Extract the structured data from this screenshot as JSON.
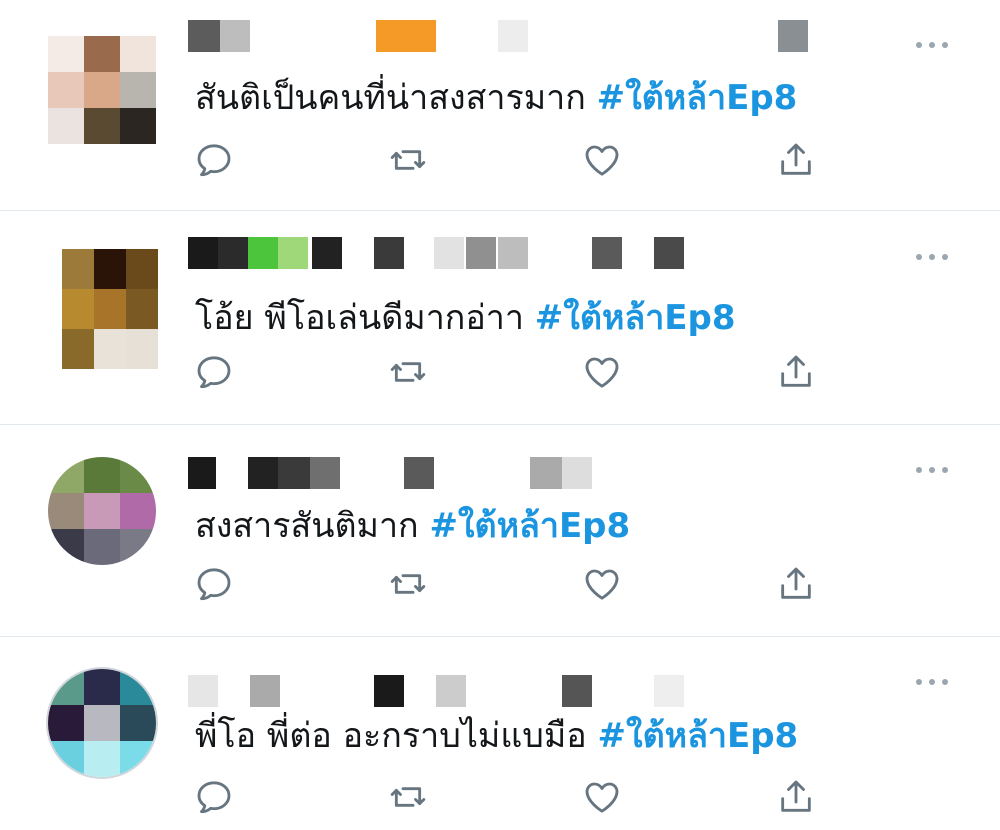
{
  "colors": {
    "hashtag": "#1b95e0",
    "text": "#14171a",
    "icon": "#66757f",
    "divider": "#e1e8ed"
  },
  "tweets": [
    {
      "text": "สันติเป็นคนที่น่าสงสารมาก ",
      "hashtag": "#ใต้หล้าEp8",
      "username": "",
      "actions": [
        "reply-icon",
        "retweet-icon",
        "like-icon",
        "share-icon"
      ]
    },
    {
      "text": "โอ้ย พีโอเล่นดีมากอ่าา ",
      "hashtag": "#ใต้หล้าEp8",
      "username": "",
      "actions": [
        "reply-icon",
        "retweet-icon",
        "like-icon",
        "share-icon"
      ]
    },
    {
      "text": "สงสารสันติมาก ",
      "hashtag": "#ใต้หล้าEp8",
      "username": "",
      "actions": [
        "reply-icon",
        "retweet-icon",
        "like-icon",
        "share-icon"
      ]
    },
    {
      "text": "พี่โอ พี่ต่อ อะกราบไม่แบมือ ",
      "hashtag": "#ใต้หล้าEp8",
      "username": "",
      "actions": [
        "reply-icon",
        "retweet-icon",
        "like-icon",
        "share-icon"
      ]
    }
  ]
}
